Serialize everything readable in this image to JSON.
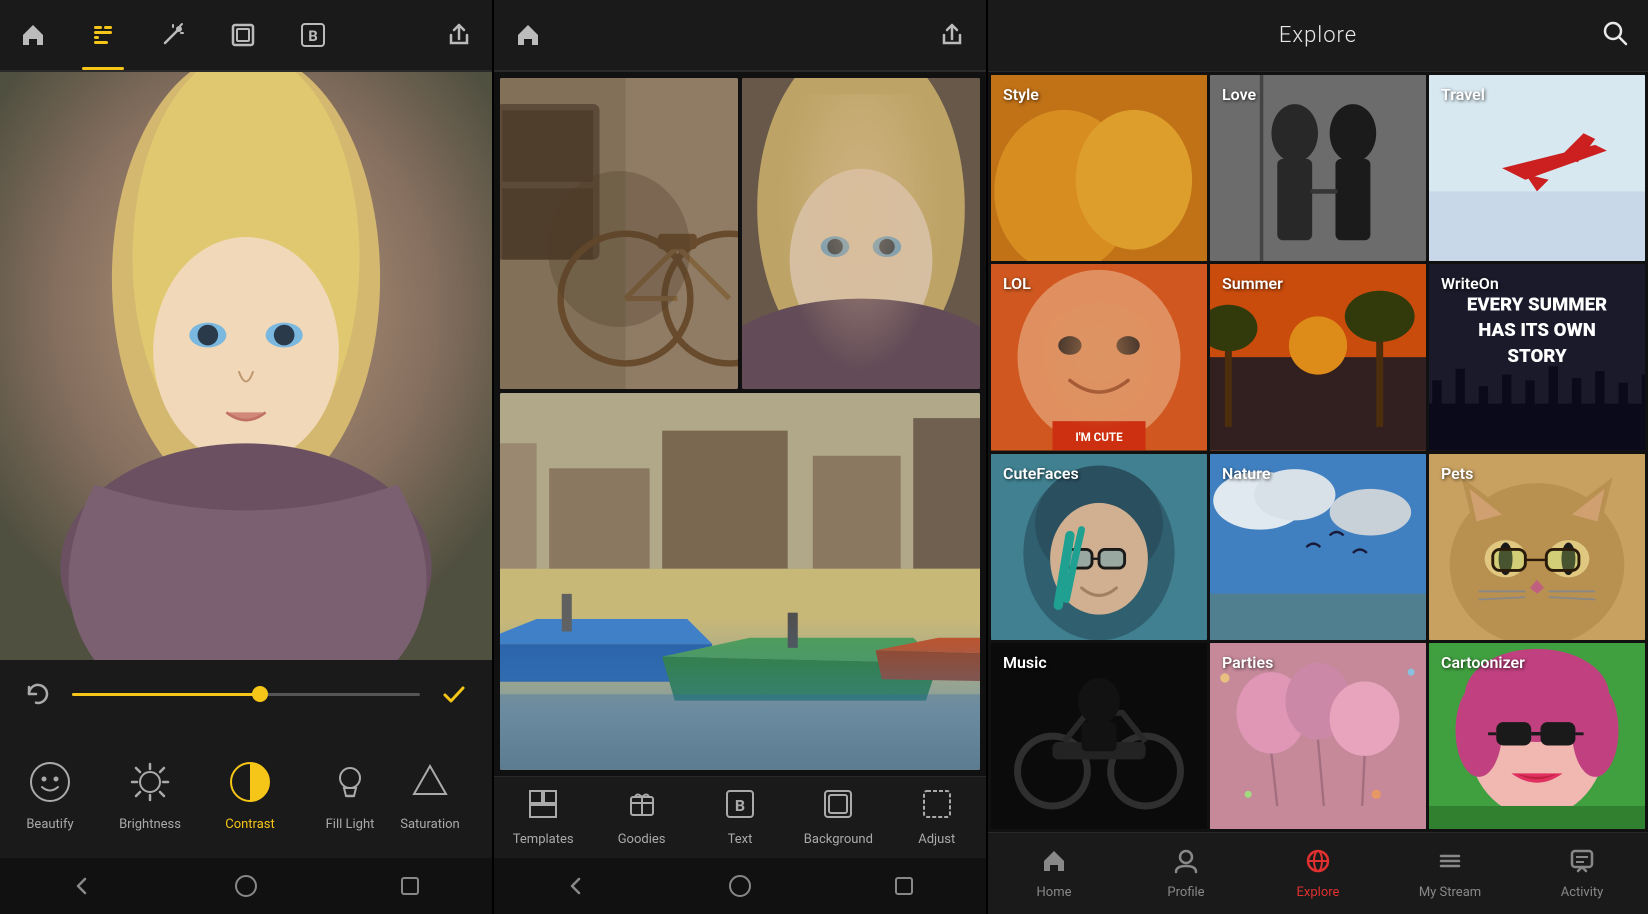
{
  "panel1": {
    "toolbar": {
      "home_label": "Home",
      "tools_label": "Tools",
      "wand_label": "Magic",
      "frame_label": "Frame",
      "text_label": "Text",
      "share_label": "Share"
    },
    "controls": {
      "undo_label": "Undo",
      "check_label": "Confirm"
    },
    "tools": [
      {
        "id": "beautify",
        "label": "Beautify",
        "active": false
      },
      {
        "id": "brightness",
        "label": "Brightness",
        "active": false
      },
      {
        "id": "contrast",
        "label": "Contrast",
        "active": true
      },
      {
        "id": "fill-light",
        "label": "Fill Light",
        "active": false
      },
      {
        "id": "saturation",
        "label": "Saturation",
        "active": false
      }
    ],
    "nav": {
      "back": "←",
      "home": "○",
      "recent": "□"
    }
  },
  "panel2": {
    "toolbar": {
      "home_label": "Home",
      "share_label": "Share"
    },
    "bottom_tools": [
      {
        "id": "templates",
        "label": "Templates"
      },
      {
        "id": "goodies",
        "label": "Goodies"
      },
      {
        "id": "text",
        "label": "Text"
      },
      {
        "id": "background",
        "label": "Background"
      },
      {
        "id": "adjust",
        "label": "Adjust"
      }
    ],
    "nav": {
      "back": "←",
      "home": "○",
      "recent": "□"
    }
  },
  "panel3": {
    "header": {
      "title": "Explore"
    },
    "grid": [
      {
        "id": "style",
        "label": "Style",
        "bg_class": "bg-style"
      },
      {
        "id": "love",
        "label": "Love",
        "bg_class": "bg-love"
      },
      {
        "id": "travel",
        "label": "Travel",
        "bg_class": "bg-travel"
      },
      {
        "id": "lol",
        "label": "LOL",
        "bg_class": "bg-lol"
      },
      {
        "id": "summer",
        "label": "Summer",
        "bg_class": "bg-summer"
      },
      {
        "id": "writeon",
        "label": "WriteOn",
        "bg_class": "bg-writeon",
        "extra_text": "EVERY SUMMER\nHAS ITS OWN\nSTORY"
      },
      {
        "id": "cutefaces",
        "label": "CuteFaces",
        "bg_class": "bg-cutefaces"
      },
      {
        "id": "nature",
        "label": "Nature",
        "bg_class": "bg-nature"
      },
      {
        "id": "pets",
        "label": "Pets",
        "bg_class": "bg-pets"
      },
      {
        "id": "music",
        "label": "Music",
        "bg_class": "bg-music"
      },
      {
        "id": "parties",
        "label": "Parties",
        "bg_class": "bg-parties"
      },
      {
        "id": "cartoonizer",
        "label": "Cartoonizer",
        "bg_class": "bg-cartoonizer"
      }
    ],
    "bottom_nav": [
      {
        "id": "home",
        "label": "Home",
        "active": false,
        "icon": "🏠"
      },
      {
        "id": "profile",
        "label": "Profile",
        "active": false,
        "icon": "👤"
      },
      {
        "id": "explore",
        "label": "Explore",
        "active": true,
        "icon": "🌐"
      },
      {
        "id": "my-stream",
        "label": "My Stream",
        "active": false,
        "icon": "≡"
      },
      {
        "id": "activity",
        "label": "Activity",
        "active": false,
        "icon": "💬"
      }
    ]
  }
}
